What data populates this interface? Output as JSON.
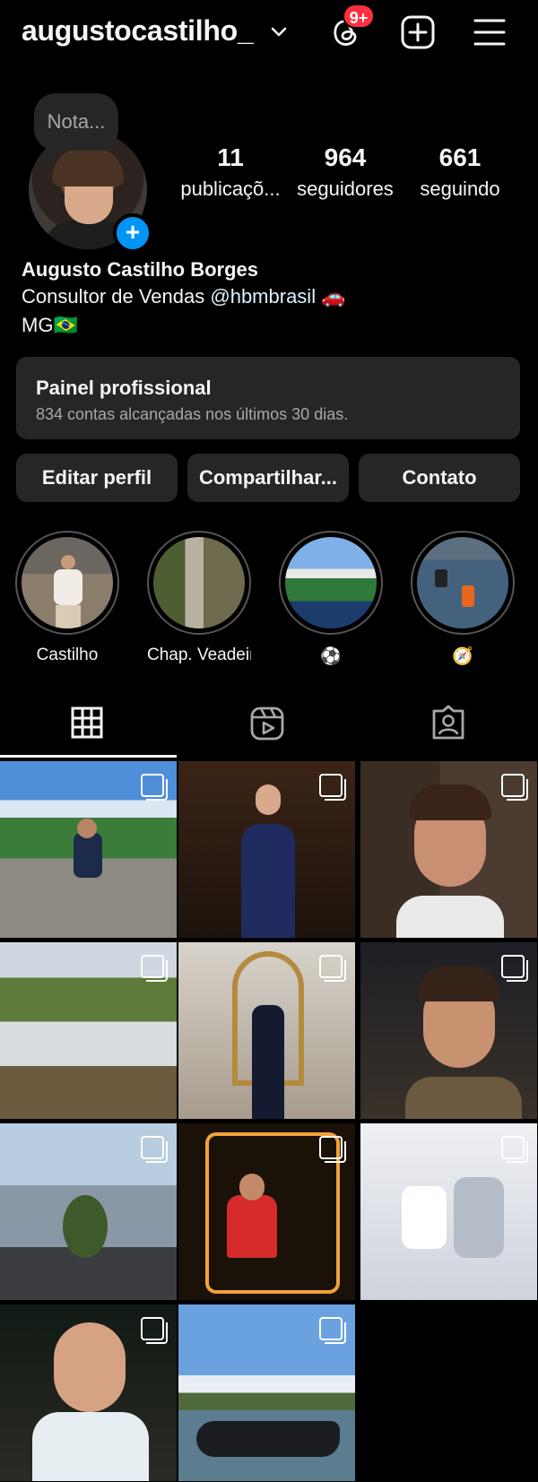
{
  "header": {
    "username": "augustocastilho_",
    "notification_badge": "9+",
    "icons": [
      "chevron-down-icon",
      "threads-icon",
      "create-post-icon",
      "menu-icon"
    ]
  },
  "profile": {
    "note_placeholder": "Nota...",
    "stats": [
      {
        "value": "11",
        "label": "publicaçõ..."
      },
      {
        "value": "964",
        "label": "seguidores"
      },
      {
        "value": "661",
        "label": "seguindo"
      }
    ],
    "full_name": "Augusto Castilho Borges",
    "bio_prefix": "Consultor de Vendas ",
    "bio_mention": "@hbmbrasil",
    "bio_emoji": "🚗",
    "bio_line2": "MG🇧🇷"
  },
  "dashboard": {
    "title": "Painel profissional",
    "subtitle": "834 contas alcançadas nos últimos 30 dias."
  },
  "actions": {
    "edit": "Editar perfil",
    "share": "Compartilhar...",
    "contact": "Contato"
  },
  "highlights": [
    {
      "label": "Castilho"
    },
    {
      "label": "Chap. Veadeir..."
    },
    {
      "label": "⚽"
    },
    {
      "label": "🧭"
    }
  ],
  "tabs": [
    "grid-icon",
    "reels-icon",
    "tagged-icon"
  ],
  "colors": {
    "background": "#000000",
    "surface": "#262626",
    "accent": "#0095f6",
    "badge": "#ff3040"
  }
}
